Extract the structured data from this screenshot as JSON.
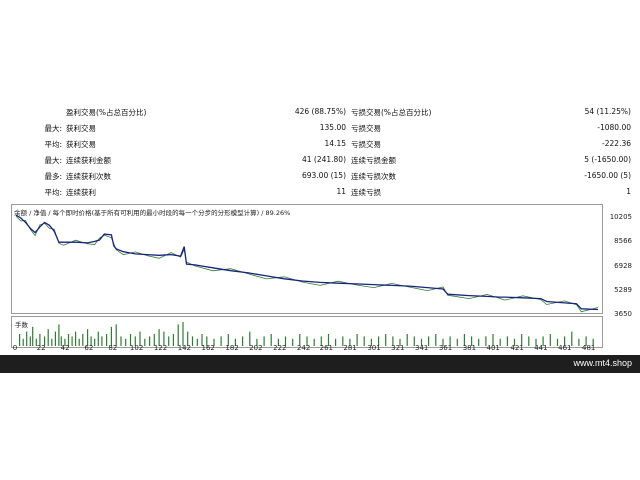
{
  "stats": {
    "rows": [
      {
        "c1": "",
        "c2": "盈利交易(%占总百分比)",
        "c3": "426 (88.75%)",
        "c4": "亏损交易(%占总百分比)",
        "c5": "54 (11.25%)"
      },
      {
        "c1": "最大:",
        "c2": "获利交易",
        "c3": "135.00",
        "c4": "亏损交易",
        "c5": "-1080.00"
      },
      {
        "c1": "平均:",
        "c2": "获利交易",
        "c3": "14.15",
        "c4": "亏损交易",
        "c5": "-222.36"
      },
      {
        "c1": "最大:",
        "c2": "连续获利金额",
        "c3": "41 (241.80)",
        "c4": "连续亏损金额",
        "c5": "5 (-1650.00)"
      },
      {
        "c1": "最多:",
        "c2": "连续获利次数",
        "c3": "693.00 (15)",
        "c4": "连续亏损次数",
        "c5": "-1650.00 (5)"
      },
      {
        "c1": "平均:",
        "c2": "连续获利",
        "c3": "11",
        "c4": "连续亏损",
        "c5": "1"
      }
    ]
  },
  "chart_header": "余额 / 净值 / 每个即时价格(基于所有可利用的最小时段的每一个分步的分形模型计算) / 89.26%",
  "volume_label": "手数",
  "watermark": "www.mt4.shop",
  "colors": {
    "balance": "#1a237e",
    "equity": "#2e7d32",
    "volume": "#2e7d32",
    "footer": "#1e1e1e"
  },
  "chart_data": {
    "type": "line",
    "y_ticks": [
      "10205",
      "8566",
      "6928",
      "5289",
      "3650"
    ],
    "x_ticks": [
      "0",
      "22",
      "42",
      "62",
      "82",
      "102",
      "122",
      "142",
      "162",
      "182",
      "202",
      "222",
      "242",
      "261",
      "281",
      "301",
      "321",
      "341",
      "361",
      "381",
      "401",
      "421",
      "441",
      "461",
      "481"
    ],
    "ylim": [
      3650,
      10205
    ],
    "xlim": [
      0,
      488
    ],
    "series": [
      {
        "x": [
          0,
          4,
          8,
          12,
          16,
          20,
          24,
          28,
          32,
          36,
          40,
          50,
          60,
          66,
          70,
          74,
          80,
          82,
          84,
          90,
          100,
          110,
          120,
          130,
          138,
          141,
          143,
          150,
          165,
          180,
          195,
          210,
          225,
          240,
          255,
          270,
          285,
          300,
          315,
          330,
          345,
          358,
          362,
          380,
          395,
          405,
          410,
          425,
          440,
          445,
          460,
          470,
          474,
          488
        ],
        "y": [
          10200,
          10000,
          9700,
          9300,
          9000,
          9400,
          9700,
          9500,
          9100,
          8350,
          8350,
          8350,
          8300,
          8400,
          8500,
          8900,
          8850,
          8100,
          7900,
          7700,
          7550,
          7500,
          7450,
          7500,
          7400,
          8050,
          6850,
          6800,
          6600,
          6400,
          6250,
          6050,
          5850,
          5700,
          5600,
          5550,
          5500,
          5450,
          5400,
          5350,
          5250,
          5150,
          4800,
          4700,
          4650,
          4600,
          4600,
          4550,
          4500,
          4300,
          4200,
          4150,
          3800,
          3750
        ]
      }
    ],
    "volume": {
      "x": [
        3,
        6,
        9,
        12,
        14,
        17,
        20,
        24,
        27,
        30,
        33,
        36,
        38,
        41,
        44,
        47,
        50,
        53,
        56,
        60,
        63,
        66,
        69,
        72,
        76,
        80,
        84,
        88,
        92,
        96,
        100,
        104,
        108,
        112,
        116,
        120,
        124,
        128,
        132,
        136,
        140,
        144,
        148,
        152,
        156,
        160,
        166,
        172,
        178,
        184,
        190,
        196,
        202,
        208,
        214,
        220,
        226,
        232,
        238,
        244,
        250,
        256,
        262,
        268,
        274,
        280,
        286,
        292,
        298,
        304,
        310,
        316,
        322,
        328,
        334,
        340,
        346,
        352,
        358,
        364,
        370,
        376,
        382,
        388,
        394,
        400,
        406,
        412,
        418,
        424,
        430,
        436,
        442,
        448,
        454,
        460,
        466,
        472,
        478,
        484
      ],
      "y": [
        0.5,
        0.3,
        0.6,
        0.4,
        0.8,
        0.3,
        0.5,
        0.4,
        0.7,
        0.3,
        0.6,
        0.9,
        0.4,
        0.3,
        0.5,
        0.4,
        0.6,
        0.3,
        0.5,
        0.7,
        0.4,
        0.3,
        0.6,
        0.4,
        0.5,
        0.8,
        0.9,
        0.4,
        0.3,
        0.5,
        0.4,
        0.6,
        0.3,
        0.4,
        0.5,
        0.7,
        0.6,
        0.4,
        0.5,
        0.9,
        1.0,
        0.6,
        0.4,
        0.3,
        0.5,
        0.4,
        0.3,
        0.4,
        0.5,
        0.3,
        0.4,
        0.6,
        0.3,
        0.4,
        0.5,
        0.3,
        0.4,
        0.3,
        0.5,
        0.4,
        0.3,
        0.4,
        0.5,
        0.3,
        0.4,
        0.3,
        0.5,
        0.4,
        0.3,
        0.4,
        0.5,
        0.4,
        0.3,
        0.5,
        0.4,
        0.3,
        0.4,
        0.5,
        0.3,
        0.4,
        0.3,
        0.5,
        0.4,
        0.3,
        0.4,
        0.5,
        0.3,
        0.4,
        0.3,
        0.5,
        0.4,
        0.3,
        0.4,
        0.5,
        0.3,
        0.4,
        0.6,
        0.3,
        0.4,
        0.3
      ]
    }
  }
}
